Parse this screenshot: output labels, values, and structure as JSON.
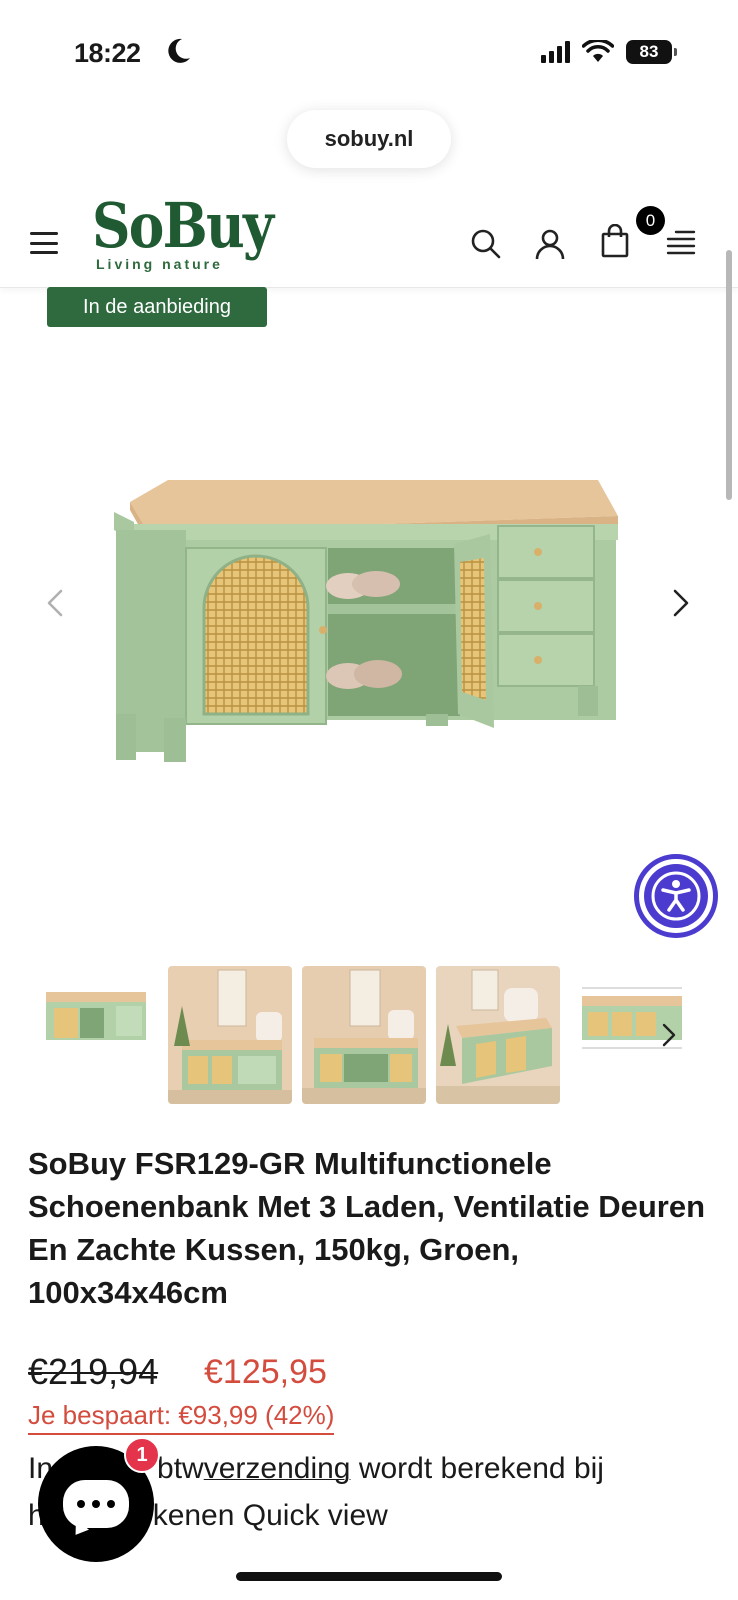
{
  "status_bar": {
    "time": "18:22",
    "battery": "83"
  },
  "browser": {
    "url": "sobuy.nl"
  },
  "header": {
    "logo_text": "SoBuy",
    "logo_tagline": "Living nature",
    "cart_count": "0"
  },
  "product": {
    "badge": "In de aanbieding",
    "title": "SoBuy FSR129-GR Multifunctionele Schoenenbank Met 3 Laden, Ventilatie Deuren En Zachte Kussen, 150kg, Groen, 100x34x46cm",
    "old_price": "€219,94",
    "new_price": "€125,95",
    "savings": "Je bespaart: €93,99 (42%)",
    "tax_prefix": "In",
    "tax_mid": "btw",
    "shipping_link": "verzending",
    "tax_suffix": " wordt berekend bij",
    "line2_prefix": "h",
    "line2_rest": "kenen Quick view"
  },
  "chat": {
    "unread": "1"
  },
  "colors": {
    "brand_green": "#1f5a32",
    "badge_green": "#2f6a3f",
    "sale_red": "#d34c3e",
    "a11y_purple": "#4b3ccf",
    "chat_badge": "#e3344b"
  },
  "icons": [
    "hamburger-icon",
    "search-icon",
    "user-icon",
    "cart-icon",
    "menu-lines-icon",
    "chevron-left-icon",
    "chevron-right-icon",
    "accessibility-icon",
    "chat-icon"
  ]
}
